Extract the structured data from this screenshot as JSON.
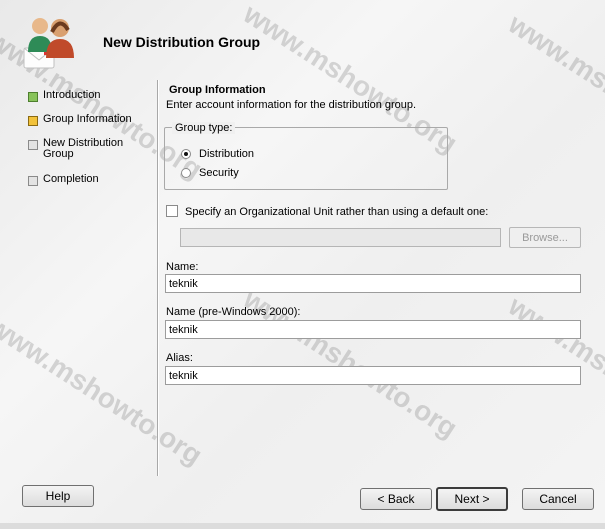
{
  "header": {
    "title": "New Distribution Group",
    "icon": "users-group-icon"
  },
  "nav": {
    "items": [
      {
        "label": "Introduction",
        "state": "done"
      },
      {
        "label": "Group Information",
        "state": "current"
      },
      {
        "label": "New Distribution Group",
        "state": "pending"
      },
      {
        "label": "Completion",
        "state": "pending"
      }
    ]
  },
  "main": {
    "section_title": "Group Information",
    "section_desc": "Enter account information for the distribution group.",
    "group_type": {
      "legend": "Group type:",
      "options": [
        {
          "label": "Distribution",
          "checked": true
        },
        {
          "label": "Security",
          "checked": false
        }
      ]
    },
    "ou_checkbox_label": "Specify an Organizational Unit rather than using a default one:",
    "ou_value": "",
    "browse_label": "Browse...",
    "name_label": "Name:",
    "name_value": "teknik",
    "pre2000_label": "Name (pre-Windows 2000):",
    "pre2000_value": "teknik",
    "alias_label": "Alias:",
    "alias_value": "teknik"
  },
  "buttons": {
    "help": "Help",
    "back": "< Back",
    "next": "Next >",
    "cancel": "Cancel"
  },
  "watermark": "www.mshowto.org",
  "colors": {
    "done": "#88c35a",
    "current": "#f2c23a",
    "pending": "#e3e3e3"
  }
}
